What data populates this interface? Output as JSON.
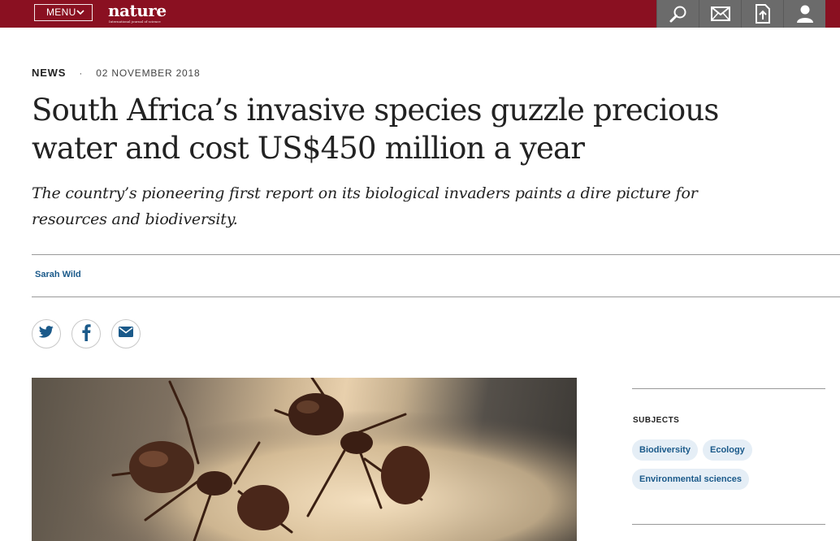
{
  "header": {
    "menu_label": "MENU",
    "logo_text": "nature",
    "logo_tagline": "International journal of science",
    "tools": [
      {
        "icon": "search-icon"
      },
      {
        "icon": "mail-icon"
      },
      {
        "icon": "submit-upload-icon"
      },
      {
        "icon": "user-icon"
      }
    ],
    "bar_color": "#8a1021"
  },
  "article": {
    "type": "NEWS",
    "separator": "·",
    "date": "02 NOVEMBER 2018",
    "title": "South Africa’s invasive species guzzle precious water and cost US$450 million a year",
    "standfirst": "The country’s pioneering first report on its biological invaders paints a dire picture for resources and biodiversity.",
    "author": "Sarah Wild"
  },
  "share": [
    {
      "icon": "twitter-icon"
    },
    {
      "icon": "facebook-icon"
    },
    {
      "icon": "email-icon"
    }
  ],
  "sidebar": {
    "subjects_heading": "SUBJECTS",
    "subjects": [
      "Biodiversity",
      "Ecology",
      "Environmental sciences"
    ]
  }
}
